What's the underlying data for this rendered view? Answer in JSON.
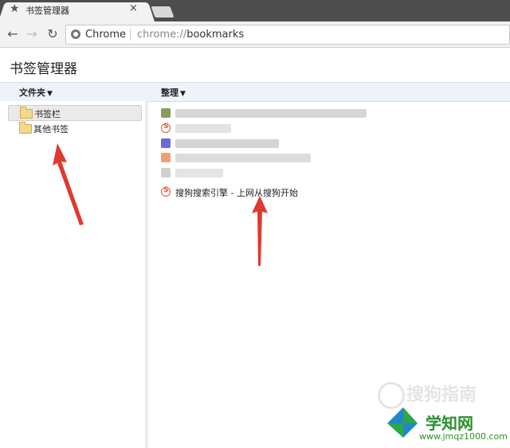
{
  "tab": {
    "title": "书签管理器",
    "star_icon": "star-icon",
    "close_label": "×"
  },
  "toolbar": {
    "back_icon": "←",
    "forward_icon": "→",
    "reload_icon": "↻",
    "site_label": "Chrome",
    "url_scheme": "chrome://",
    "url_path": "bookmarks"
  },
  "page": {
    "title": "书签管理器"
  },
  "columns": {
    "folders": "文件夹",
    "organize": "整理",
    "caret": "▼"
  },
  "folders": [
    {
      "label": "书签栏",
      "selected": true
    },
    {
      "label": "其他书签",
      "selected": false
    }
  ],
  "bookmarks": [
    {
      "icon": "blurred-favicon",
      "title": "",
      "color": "#8a9a5b"
    },
    {
      "icon": "sogou-icon",
      "title": "",
      "color": "#e8572e"
    },
    {
      "icon": "image-favicon",
      "title": "",
      "color": "#6a6ad8"
    },
    {
      "icon": "blurred-favicon",
      "title": "",
      "color": "#f2a070"
    },
    {
      "icon": "blurred-favicon",
      "title": "",
      "color": "#d0d0d0"
    },
    {
      "icon": "sogou-icon",
      "title": "搜狗搜索引擎 - 上网从搜狗开始",
      "color": "#e8572e"
    }
  ],
  "watermarks": {
    "sogou_guide": "搜狗指南",
    "site_name": "学知网",
    "site_url": "www.jmqz1000.com"
  },
  "colors": {
    "arrow": "#e03a2f",
    "accent_bar": "#eef3fb"
  }
}
